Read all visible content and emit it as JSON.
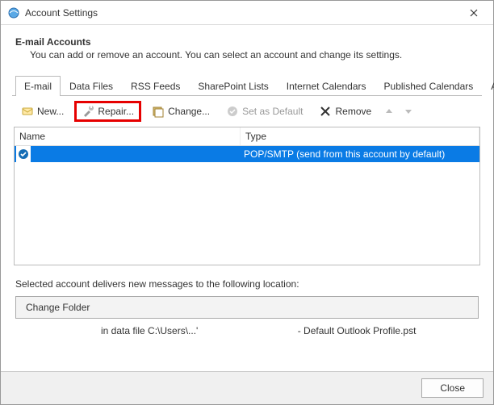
{
  "window": {
    "title": "Account Settings"
  },
  "section": {
    "title": "E-mail Accounts",
    "desc": "You can add or remove an account. You can select an account and change its settings."
  },
  "tabs": {
    "0": {
      "label": "E-mail"
    },
    "1": {
      "label": "Data Files"
    },
    "2": {
      "label": "RSS Feeds"
    },
    "3": {
      "label": "SharePoint Lists"
    },
    "4": {
      "label": "Internet Calendars"
    },
    "5": {
      "label": "Published Calendars"
    },
    "6": {
      "label": "Address Books"
    }
  },
  "toolbar": {
    "new": "New...",
    "repair": "Repair...",
    "change": "Change...",
    "set_default": "Set as Default",
    "remove": "Remove"
  },
  "list": {
    "headers": {
      "name": "Name",
      "type": "Type"
    },
    "row0": {
      "name": "",
      "type": "POP/SMTP (send from this account by default)"
    }
  },
  "info": {
    "delivers": "Selected account delivers new messages to the following location:",
    "change_folder": "Change Folder",
    "path": "in data file C:\\Users\\...'                                     - Default Outlook Profile.pst"
  },
  "footer": {
    "close": "Close"
  }
}
